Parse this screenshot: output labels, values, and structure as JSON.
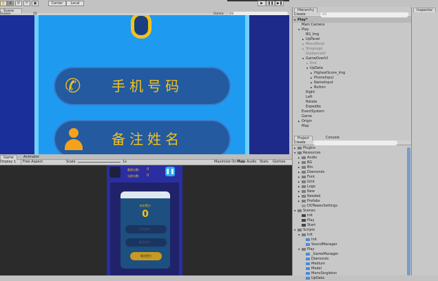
{
  "toolbar": {
    "center": "Center",
    "local": "Local",
    "play": "▶",
    "pause": "❚❚",
    "step": "▶❚"
  },
  "scene": {
    "tab": "Scene",
    "shaded": "Shaded",
    "mode2d": "2D",
    "gizmos": "Gizmos",
    "search": "All",
    "score": "0",
    "phone": "手机号码",
    "name": "备注姓名"
  },
  "game": {
    "tab": "Game",
    "animator_tab": "Animator",
    "display": "Display 1",
    "aspect": "Free Aspect",
    "scale_label": "Scale",
    "scale_value": "1x",
    "maximize": "Maximize On Play",
    "mute": "Mute Audio",
    "stats": "Stats",
    "gizmos": "Gizmos",
    "best_label": "最高分数:",
    "best": "0",
    "current_label": "当前分数:",
    "current": "0",
    "title": "本次得分:",
    "score": "0",
    "phone": "手机号码",
    "name": "备注姓名",
    "submit": "确定提交"
  },
  "hierarchy": {
    "tab": "Hierarchy",
    "create": "Create",
    "search": "All",
    "items": [
      {
        "label": "Play*",
        "depth": 0,
        "arrow": "▼"
      },
      {
        "label": "Main Camera",
        "depth": 1,
        "arrow": ""
      },
      {
        "label": "Play",
        "depth": 1,
        "arrow": "▼"
      },
      {
        "label": "BG_Img",
        "depth": 2,
        "arrow": ""
      },
      {
        "label": "UpPanel",
        "depth": 2,
        "arrow": "▶"
      },
      {
        "label": "MenuPanel",
        "depth": 2,
        "arrow": "▶",
        "dim": true
      },
      {
        "label": "ShopLogo",
        "depth": 2,
        "arrow": "▶",
        "dim": true
      },
      {
        "label": "GuidanceUI",
        "depth": 2,
        "arrow": "",
        "dim": true
      },
      {
        "label": "GameOverUI",
        "depth": 2,
        "arrow": "▼"
      },
      {
        "label": "End",
        "depth": 3,
        "arrow": "▶",
        "dim": true
      },
      {
        "label": "UpData",
        "depth": 3,
        "arrow": "▼"
      },
      {
        "label": "HighestScore_Img",
        "depth": 4,
        "arrow": "▶"
      },
      {
        "label": "PhoneInput",
        "depth": 4,
        "arrow": "▶"
      },
      {
        "label": "NameInput",
        "depth": 4,
        "arrow": "▶"
      },
      {
        "label": "Button",
        "depth": 4,
        "arrow": "▶"
      },
      {
        "label": "Right",
        "depth": 2,
        "arrow": ""
      },
      {
        "label": "Left",
        "depth": 2,
        "arrow": ""
      },
      {
        "label": "Rotate",
        "depth": 2,
        "arrow": ""
      },
      {
        "label": "Expedite",
        "depth": 2,
        "arrow": ""
      },
      {
        "label": "EventSystem",
        "depth": 1,
        "arrow": ""
      },
      {
        "label": "Game",
        "depth": 1,
        "arrow": ""
      },
      {
        "label": "Origin",
        "depth": 1,
        "arrow": "▶"
      },
      {
        "label": "Map",
        "depth": 1,
        "arrow": ""
      }
    ]
  },
  "inspector": {
    "tab": "Inspector"
  },
  "project": {
    "tab": "Project",
    "console_tab": "Console",
    "create": "Create",
    "items": [
      {
        "label": "Plugins",
        "depth": 0,
        "arrow": "▶",
        "icon": "folder"
      },
      {
        "label": "Resources",
        "depth": 0,
        "arrow": "▼",
        "icon": "folder"
      },
      {
        "label": "Audio",
        "depth": 1,
        "arrow": "▶",
        "icon": "folder"
      },
      {
        "label": "BG",
        "depth": 1,
        "arrow": "▶",
        "icon": "folder"
      },
      {
        "label": "Btn",
        "depth": 1,
        "arrow": "▶",
        "icon": "folder"
      },
      {
        "label": "Diamonds",
        "depth": 1,
        "arrow": "▶",
        "icon": "folder"
      },
      {
        "label": "Font",
        "depth": 1,
        "arrow": "▶",
        "icon": "folder"
      },
      {
        "label": "Grid",
        "depth": 1,
        "arrow": "▶",
        "icon": "folder"
      },
      {
        "label": "Logo",
        "depth": 1,
        "arrow": "▶",
        "icon": "folder"
      },
      {
        "label": "New",
        "depth": 1,
        "arrow": "▶",
        "icon": "folder"
      },
      {
        "label": "Needed",
        "depth": 1,
        "arrow": "▶",
        "icon": "folder"
      },
      {
        "label": "Prefabs",
        "depth": 1,
        "arrow": "▶",
        "icon": "folder"
      },
      {
        "label": "DOTweenSettings",
        "depth": 1,
        "arrow": "",
        "icon": "asset"
      },
      {
        "label": "Scenes",
        "depth": 0,
        "arrow": "▼",
        "icon": "folder"
      },
      {
        "label": "Init",
        "depth": 1,
        "arrow": "",
        "icon": "scene"
      },
      {
        "label": "Play",
        "depth": 1,
        "arrow": "",
        "icon": "scene"
      },
      {
        "label": "Start",
        "depth": 1,
        "arrow": "",
        "icon": "scene"
      },
      {
        "label": "Scripts",
        "depth": 0,
        "arrow": "▼",
        "icon": "folder"
      },
      {
        "label": "Init",
        "depth": 1,
        "arrow": "▼",
        "icon": "folder"
      },
      {
        "label": "Init",
        "depth": 2,
        "arrow": "",
        "icon": "script"
      },
      {
        "label": "SoundManager",
        "depth": 2,
        "arrow": "",
        "icon": "script"
      },
      {
        "label": "Play",
        "depth": 1,
        "arrow": "▼",
        "icon": "folder"
      },
      {
        "label": "_GameManager",
        "depth": 2,
        "arrow": "",
        "icon": "script"
      },
      {
        "label": "Diamonds",
        "depth": 2,
        "arrow": "",
        "icon": "script"
      },
      {
        "label": "Medium",
        "depth": 2,
        "arrow": "",
        "icon": "script"
      },
      {
        "label": "Model",
        "depth": 2,
        "arrow": "",
        "icon": "script"
      },
      {
        "label": "MonoSingleton",
        "depth": 2,
        "arrow": "",
        "icon": "script"
      },
      {
        "label": "UpData",
        "depth": 2,
        "arrow": "",
        "icon": "script"
      }
    ]
  }
}
